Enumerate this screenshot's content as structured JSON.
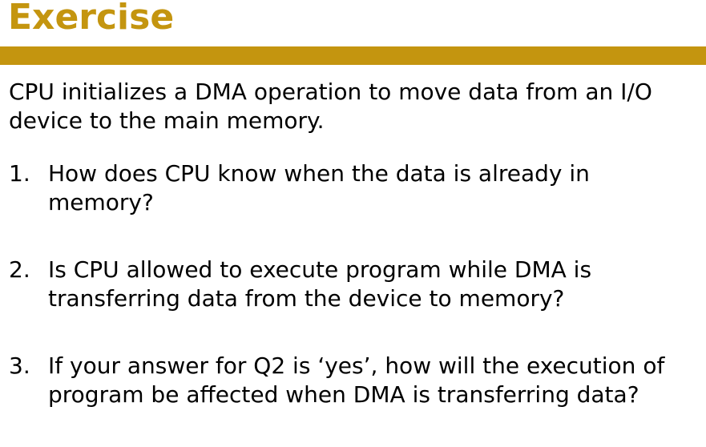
{
  "slide": {
    "title": "Exercise",
    "accent_color": "#C4950F",
    "intro": "CPU initializes a DMA operation to move data from an I/O device to the main memory.",
    "questions": [
      {
        "number": "1.",
        "text": "How does CPU know when the data is already in memory?"
      },
      {
        "number": "2.",
        "text": "Is CPU allowed to execute program while DMA is transferring data from the device to memory?"
      },
      {
        "number": "3.",
        "text": "If your answer for Q2 is ‘yes’, how will the execution of program be affected when DMA is transferring data?"
      }
    ]
  }
}
